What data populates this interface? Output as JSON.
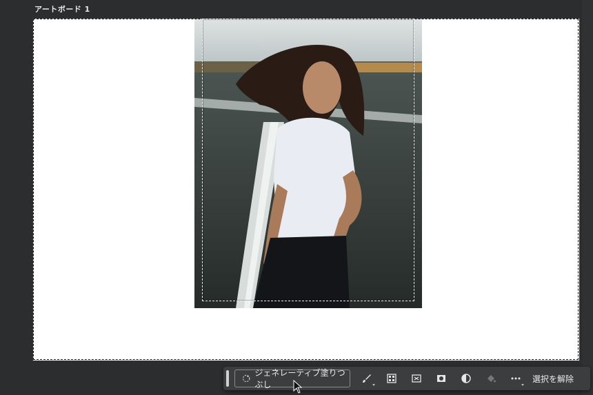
{
  "artboard": {
    "label": "アートボード 1"
  },
  "toolbar": {
    "generative_fill_label": "ジェネレーティブ塗りつぶし",
    "deselect_label": "選択を解除",
    "icons": [
      "brush-icon",
      "mask-grid-icon",
      "transform-icon",
      "mask-circle-icon",
      "adjustment-icon",
      "fill-bucket-icon",
      "more-icon"
    ]
  },
  "colors": {
    "canvas_bg": "#2b2d2e",
    "artboard_bg": "#ffffff",
    "toolbar_bg": "#3b3d3f",
    "toolbar_text": "#eaeaea"
  }
}
